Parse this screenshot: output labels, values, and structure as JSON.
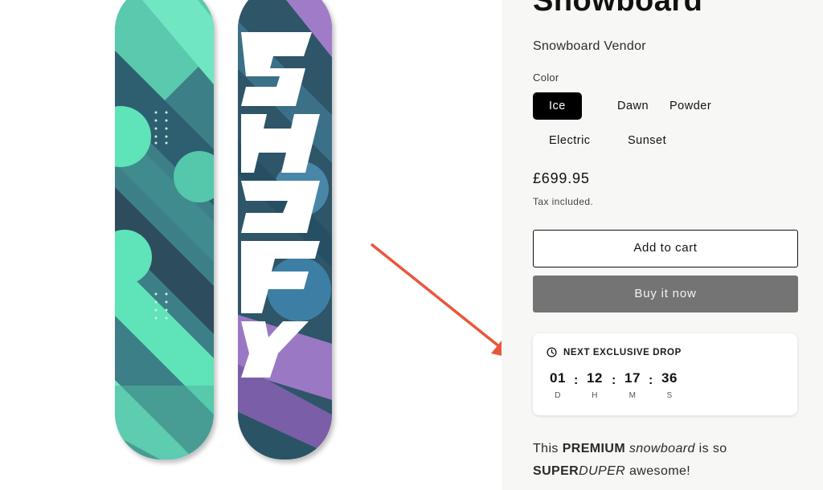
{
  "product": {
    "title": "Snowboard",
    "vendor": "Snowboard Vendor",
    "color_label": "Color",
    "colors": [
      "Ice",
      "Dawn",
      "Powder",
      "Electric",
      "Sunset"
    ],
    "selected_color": "Ice",
    "price": "£699.95",
    "tax_note": "Tax included.",
    "add_to_cart_label": "Add to cart",
    "buy_now_label": "Buy it now"
  },
  "countdown": {
    "title": "NEXT EXCLUSIVE DROP",
    "days": "01",
    "hours": "12",
    "minutes": "17",
    "seconds": "36",
    "days_label": "D",
    "hours_label": "H",
    "minutes_label": "M",
    "seconds_label": "S",
    "separator": ":"
  },
  "description": {
    "this": "This",
    "premium": "PREMIUM",
    "snowboard": "snowboard",
    "is_so": "is so",
    "super": "SUPER",
    "duper": "DUPER",
    "awesome": "awesome!"
  },
  "board_graphic_text": "SHOPIFY",
  "colors": {
    "board_teal": "#5fe3b9",
    "board_dark": "#2d4d5c",
    "board_purple": "#a07bc8",
    "arrow_red": "#e8573a",
    "panel_bg": "#f7f7f5",
    "buy_button": "#747474"
  },
  "icons": {
    "clock": "clock-icon",
    "arrow": "red-annotation-arrow"
  }
}
